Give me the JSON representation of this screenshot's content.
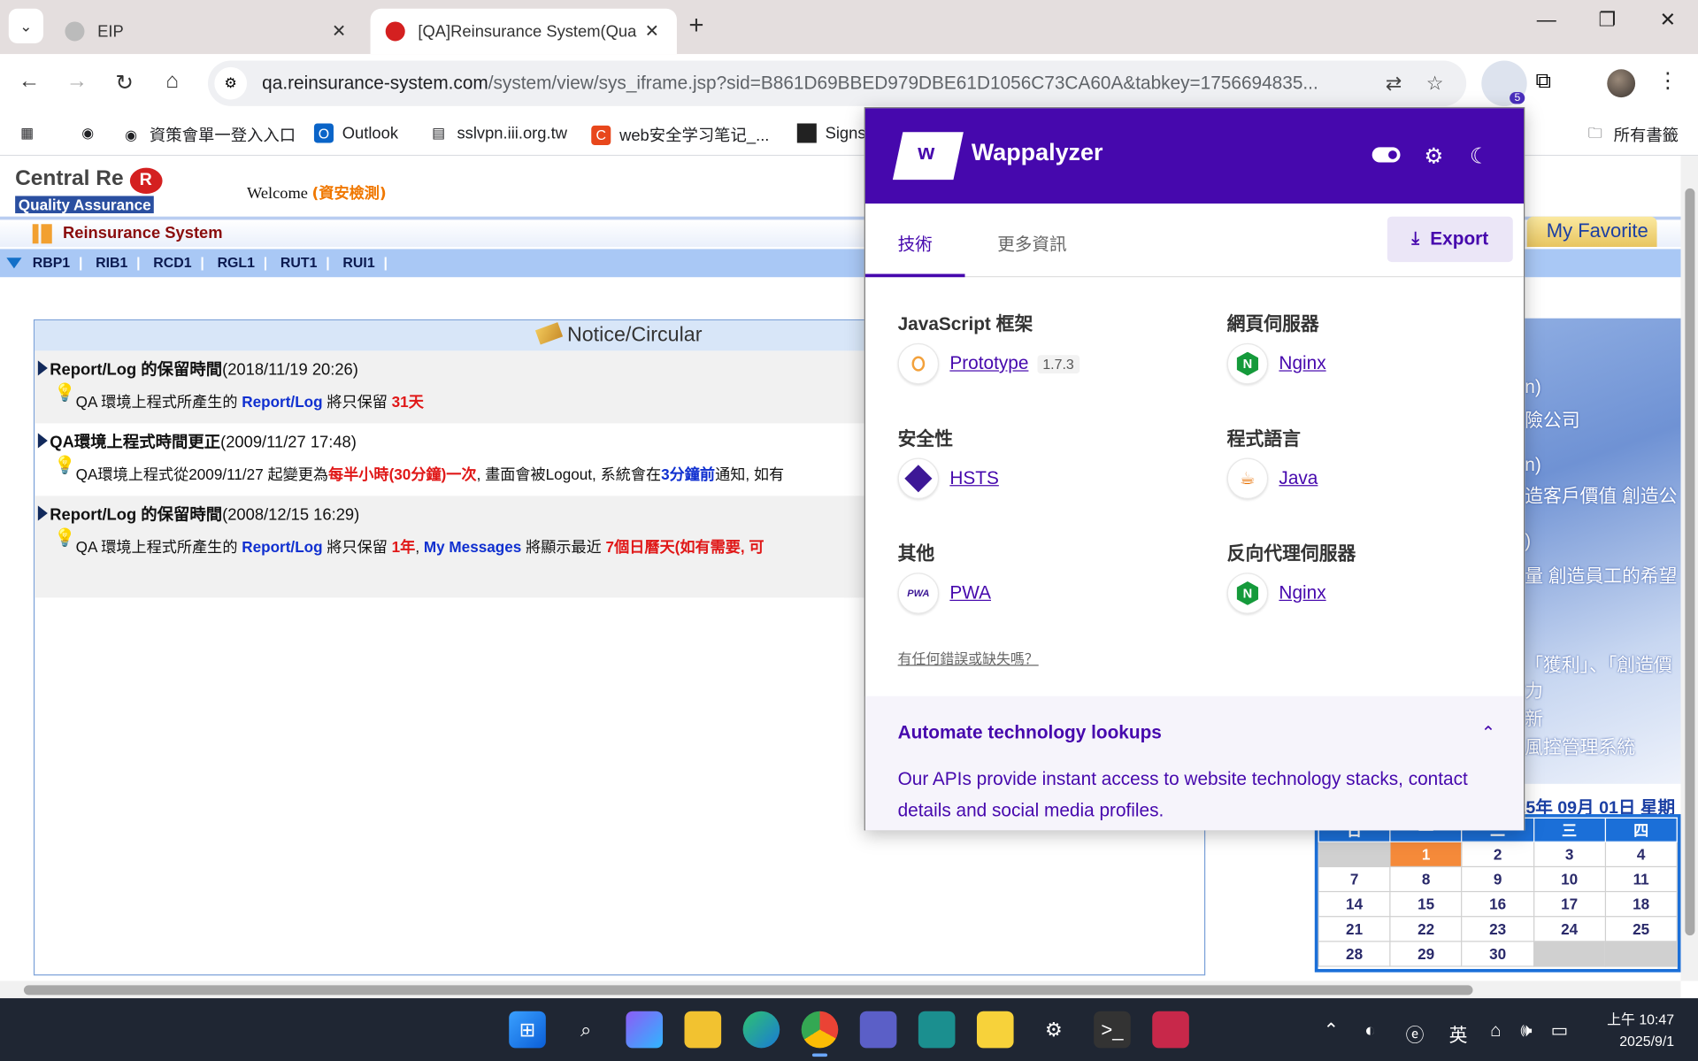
{
  "browser": {
    "tabs": [
      {
        "title": "EIP",
        "active": false
      },
      {
        "title": "[QA]Reinsurance System(Qua",
        "active": true
      }
    ],
    "url_host": "qa.reinsurance-system.com",
    "url_path": "/system/view/sys_iframe.jsp?sid=B861D69BBED979DBE61D1056C73CA60A&tabkey=1756694835...",
    "extension_badge": "5",
    "bookmarks": [
      "資策會單一登入入口",
      "Outlook",
      "sslvpn.iii.org.tw",
      "web安全学习笔记_...",
      "Signs"
    ],
    "bookmarks_folder": "所有書籤"
  },
  "page": {
    "logo_text": "Central Re",
    "logo_r": "R",
    "logo_qa": "Quality Assurance",
    "welcome_label": "Welcome",
    "welcome_name": "(資安檢測)",
    "system_title": "Reinsurance System",
    "menu": [
      "RBP1",
      "RIB1",
      "RCD1",
      "RGL1",
      "RUT1",
      "RUI1"
    ],
    "my_favorite": "My Favorite",
    "notice_title": "Notice/Circular",
    "notices": [
      {
        "title": "Report/Log 的保留時間",
        "date": "(2018/11/19 20:26)",
        "line_a": "QA 環境上程式所產生的 ",
        "hl1": "Report/Log",
        "line_b": "  將只保留 ",
        "hl2": "31天"
      },
      {
        "title": "QA環境上程式時間更正",
        "date": "(2009/11/27 17:48)",
        "line_a": "QA環境上程式從2009/11/27 起變更為",
        "hl1": "每半小時(30分鐘)一次",
        "line_b": ", 畫面會被Logout, 系統會在",
        "hl2": "3分鐘前",
        "line_c": "通知, 如有"
      },
      {
        "title": "Report/Log 的保留時間",
        "date": "(2008/12/15 16:29)",
        "line_a": "QA 環境上程式所產生的 ",
        "hl1": "Report/Log",
        "line_b": "  將只保留 ",
        "hl2": "1年",
        "line_c": ",  ",
        "hl3": "My Messages",
        "line_d": " 將顯示最近 ",
        "hl4": "7個日曆天(如有需要, 可"
      }
    ],
    "right_lines": [
      "n)",
      "險公司",
      "n)",
      "造客戶價值   創造公",
      ")",
      "量   創造員工的希望",
      "「獲利」、「創造價",
      "力",
      "新",
      "風控管理系統"
    ],
    "calendar_title": "25年 09月 01日 星期",
    "calendar_headers": [
      "日",
      "一",
      "二",
      "三",
      "四"
    ],
    "calendar_rows": [
      [
        "",
        "1",
        "2",
        "3",
        "4"
      ],
      [
        "7",
        "8",
        "9",
        "10",
        "11"
      ],
      [
        "14",
        "15",
        "16",
        "17",
        "18"
      ],
      [
        "21",
        "22",
        "23",
        "24",
        "25"
      ],
      [
        "28",
        "29",
        "30",
        "",
        ""
      ]
    ]
  },
  "wappalyzer": {
    "brand": "Wappalyzer",
    "tab_tech": "技術",
    "tab_more": "更多資訊",
    "export_label": "Export",
    "categories": [
      {
        "name": "JavaScript 框架",
        "tech": "Prototype",
        "version": "1.7.3",
        "icon": "prototype-icon"
      },
      {
        "name": "網頁伺服器",
        "tech": "Nginx",
        "version": "",
        "icon": "nginx-icon"
      },
      {
        "name": "安全性",
        "tech": "HSTS",
        "version": "",
        "icon": "hsts-icon"
      },
      {
        "name": "程式語言",
        "tech": "Java",
        "version": "",
        "icon": "java-icon"
      },
      {
        "name": "其他",
        "tech": "PWA",
        "version": "",
        "icon": "pwa-icon"
      },
      {
        "name": "反向代理伺服器",
        "tech": "Nginx",
        "version": "",
        "icon": "nginx-icon"
      }
    ],
    "report_link": "有任何錯誤或缺失嗎？",
    "footer_title": "Automate technology lookups",
    "footer_text": "Our APIs provide instant access to website technology stacks, contact details and social media profiles.",
    "brand_color": "#4608ad"
  },
  "taskbar": {
    "lang": "英",
    "time": "上午 10:47",
    "date": "2025/9/1"
  }
}
